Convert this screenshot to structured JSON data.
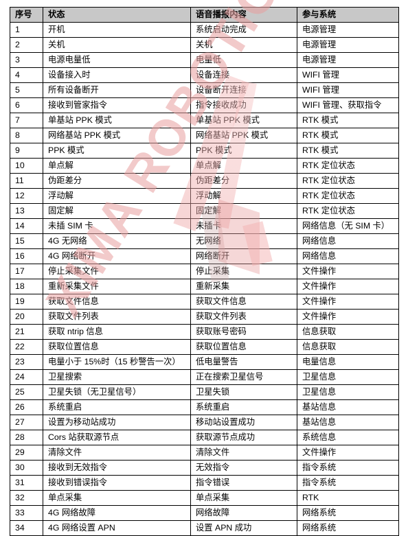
{
  "document": {
    "watermark": {
      "text": "XIMA ROBOTICS",
      "color": "#e8a0a0"
    }
  },
  "table": {
    "headers": {
      "index": "序号",
      "status": "状态",
      "voice": "语音播报内容",
      "system": "参与系统"
    },
    "rows": [
      {
        "index": "1",
        "status": "开机",
        "voice": "系统启动完成",
        "system": "电源管理"
      },
      {
        "index": "2",
        "status": "关机",
        "voice": "关机",
        "system": "电源管理"
      },
      {
        "index": "3",
        "status": "电源电量低",
        "voice": "电量低",
        "system": "电源管理"
      },
      {
        "index": "4",
        "status": "设备接入时",
        "voice": "设备连接",
        "system": "WIFI 管理"
      },
      {
        "index": "5",
        "status": "所有设备断开",
        "voice": "设备断开连接",
        "system": "WIFI 管理"
      },
      {
        "index": "6",
        "status": "接收到管家指令",
        "voice": "指令接收成功",
        "system": "WIFI 管理、获取指令"
      },
      {
        "index": "7",
        "status": "单基站 PPK 模式",
        "voice": "单基站 PPK 模式",
        "system": "RTK 模式"
      },
      {
        "index": "8",
        "status": "网络基站 PPK 模式",
        "voice": "网络基站 PPK 模式",
        "system": "RTK 模式"
      },
      {
        "index": "9",
        "status": "PPK 模式",
        "voice": "PPK 模式",
        "system": "RTK 模式"
      },
      {
        "index": "10",
        "status": "单点解",
        "voice": "单点解",
        "system": "RTK 定位状态"
      },
      {
        "index": "11",
        "status": "伪距差分",
        "voice": "伪距差分",
        "system": "RTK 定位状态"
      },
      {
        "index": "12",
        "status": "浮动解",
        "voice": "浮动解",
        "system": "RTK 定位状态"
      },
      {
        "index": "13",
        "status": "固定解",
        "voice": "固定解",
        "system": "RTK 定位状态"
      },
      {
        "index": "14",
        "status": "未插 SIM 卡",
        "voice": "未插卡",
        "system": "网络信息（无 SIM 卡）"
      },
      {
        "index": "15",
        "status": "4G 无网络",
        "voice": "无网络",
        "system": "网络信息"
      },
      {
        "index": "16",
        "status": "4G 网络断开",
        "voice": "网络断开",
        "system": "网络信息"
      },
      {
        "index": "17",
        "status": "停止采集文件",
        "voice": "停止采集",
        "system": "文件操作"
      },
      {
        "index": "18",
        "status": "重新采集文件",
        "voice": "重新采集",
        "system": "文件操作"
      },
      {
        "index": "19",
        "status": "获取文件信息",
        "voice": "获取文件信息",
        "system": "文件操作"
      },
      {
        "index": "20",
        "status": "获取文件列表",
        "voice": "获取文件列表",
        "system": "文件操作"
      },
      {
        "index": "21",
        "status": "获取 ntrip 信息",
        "voice": "获取账号密码",
        "system": "信息获取"
      },
      {
        "index": "22",
        "status": "获取位置信息",
        "voice": "获取位置信息",
        "system": "信息获取"
      },
      {
        "index": "23",
        "status": "电量小于 15%时（15 秒警告一次）",
        "voice": "低电量警告",
        "system": "电量信息"
      },
      {
        "index": "24",
        "status": "卫星搜索",
        "voice": "正在搜索卫星信号",
        "system": "卫星信息"
      },
      {
        "index": "25",
        "status": "卫星失锁（无卫星信号）",
        "voice": "卫星失锁",
        "system": "卫星信息"
      },
      {
        "index": "26",
        "status": "系统重启",
        "voice": "系统重启",
        "system": "基站信息"
      },
      {
        "index": "27",
        "status": "设置为移动站成功",
        "voice": "移动站设置成功",
        "system": "基站信息"
      },
      {
        "index": "28",
        "status": "Cors 站获取源节点",
        "voice": "获取源节点成功",
        "system": "系统信息"
      },
      {
        "index": "29",
        "status": "清除文件",
        "voice": "清除文件",
        "system": "文件操作"
      },
      {
        "index": "30",
        "status": "接收到无效指令",
        "voice": "无效指令",
        "system": "指令系统"
      },
      {
        "index": "31",
        "status": "接收到错误指令",
        "voice": "指令错误",
        "system": "指令系统"
      },
      {
        "index": "32",
        "status": "单点采集",
        "voice": "单点采集",
        "system": "RTK"
      },
      {
        "index": "33",
        "status": "4G 网络故障",
        "voice": "网络故障",
        "system": "网络系统"
      },
      {
        "index": "34",
        "status": "4G 网络设置 APN",
        "voice": "设置 APN 成功",
        "system": "网络系统"
      }
    ]
  }
}
